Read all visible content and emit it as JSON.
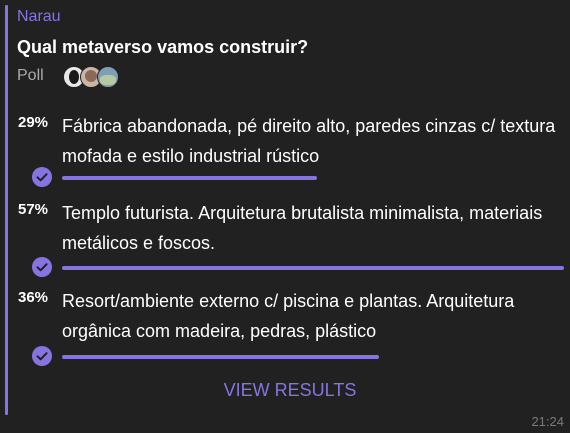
{
  "message": {
    "sender": "Narau",
    "question": "Qual metaverso vamos construir?",
    "poll_label": "Poll",
    "timestamp": "21:24",
    "accent_color": "#8774e1"
  },
  "voters": [
    "avatar-1",
    "avatar-2",
    "avatar-3"
  ],
  "options": [
    {
      "percent_label": "29%",
      "percent": 29,
      "text": "Fábrica abandonada, pé direito alto, paredes cinzas c/ textura mofada e estilo industrial rústico",
      "selected": true
    },
    {
      "percent_label": "57%",
      "percent": 57,
      "text": "Templo futurista. Arquitetura brutalista minimalista, materiais metálicos e foscos.",
      "selected": true
    },
    {
      "percent_label": "36%",
      "percent": 36,
      "text": "Resort/ambiente externo c/ piscina e plantas. Arquitetura orgânica com madeira, pedras, plástico",
      "selected": true
    }
  ],
  "actions": {
    "view_results_label": "VIEW RESULTS"
  },
  "icons": {
    "check": "check-icon"
  }
}
